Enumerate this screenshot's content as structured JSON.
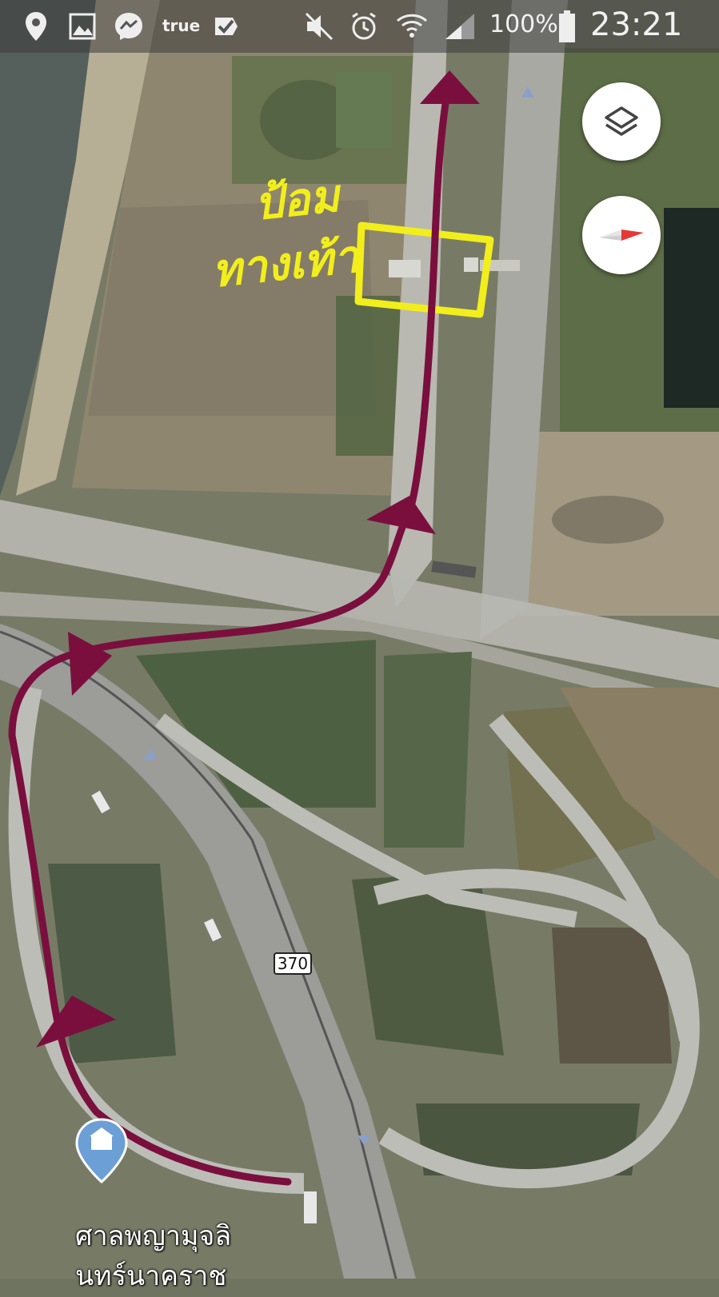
{
  "status_bar": {
    "carrier": "true",
    "battery": "100%",
    "time": "23:21",
    "icons_left": [
      "location-icon",
      "gallery-icon",
      "messenger-icon",
      "true-carrier-icon",
      "checkmark-app-icon"
    ],
    "icons_right": [
      "mute-icon",
      "alarm-icon",
      "wifi-icon",
      "signal-icon",
      "battery-icon"
    ]
  },
  "map": {
    "road_shield": "370",
    "place_name_line1": "ศาลพญามุจลิ",
    "place_name_line2": "นทร์นาคราช",
    "handwritten_line1": "ป้อม",
    "handwritten_line2": "ทางเท้า",
    "route_color": "#7a0f3e",
    "highlight_color": "#f2ee1c",
    "view": "satellite"
  },
  "controls": {
    "layers_button": "layers-icon",
    "compass_button": "compass-icon"
  }
}
